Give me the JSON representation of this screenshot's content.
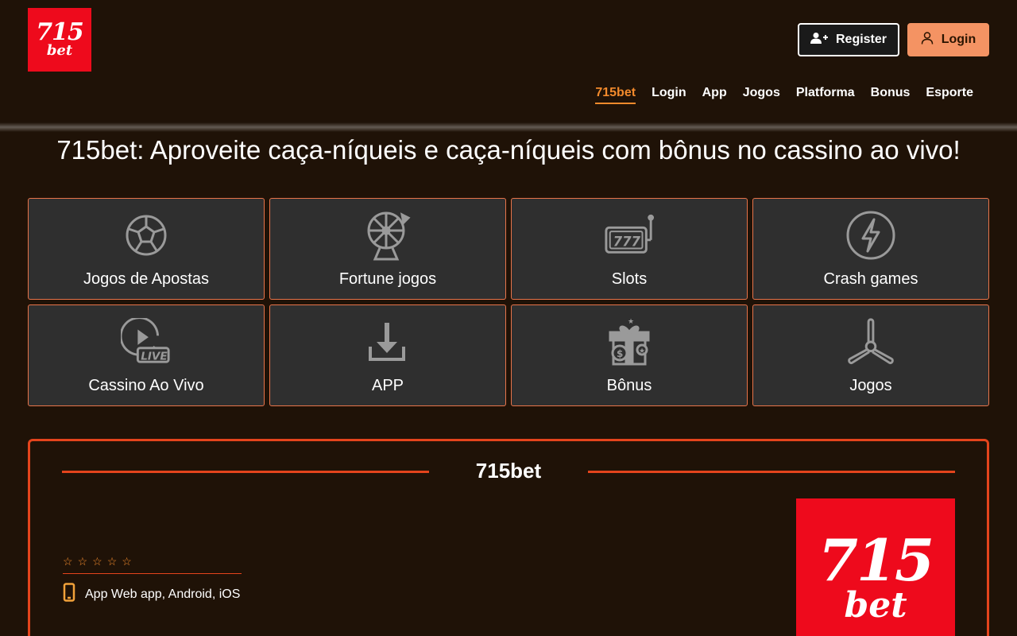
{
  "header": {
    "logo": {
      "top": "715",
      "bottom": "bet"
    },
    "register_label": "Register",
    "login_label": "Login"
  },
  "nav": {
    "items": [
      {
        "label": "715bet",
        "active": true
      },
      {
        "label": "Login"
      },
      {
        "label": "App"
      },
      {
        "label": "Jogos"
      },
      {
        "label": "Platforma"
      },
      {
        "label": "Bonus"
      },
      {
        "label": "Esporte"
      }
    ]
  },
  "page_title": "715bet: Aproveite caça-níqueis e caça-níqueis com bônus no cassino ao vivo!",
  "tiles": [
    {
      "label": "Jogos de Apostas",
      "icon": "soccer-ball-icon"
    },
    {
      "label": "Fortune jogos",
      "icon": "fortune-wheel-icon"
    },
    {
      "label": "Slots",
      "icon": "slot-machine-icon"
    },
    {
      "label": "Crash games",
      "icon": "lightning-icon"
    },
    {
      "label": "Cassino Ao Vivo",
      "icon": "live-play-icon"
    },
    {
      "label": "APP",
      "icon": "download-icon"
    },
    {
      "label": "Bônus",
      "icon": "gift-icon"
    },
    {
      "label": "Jogos",
      "icon": "propeller-icon"
    }
  ],
  "info": {
    "title": "715bet",
    "stars": [
      "☆",
      "☆",
      "☆",
      "☆",
      "☆"
    ],
    "app_text": "App Web app, Android, iOS",
    "logo": {
      "top": "715",
      "bottom": "bet"
    }
  },
  "colors": {
    "background": "#1f1207",
    "accent": "#f28a2c",
    "border": "#e4441c",
    "login_button": "#f49363",
    "logo_red": "#ee0a1c",
    "tile_bg": "#2f2f2f"
  }
}
